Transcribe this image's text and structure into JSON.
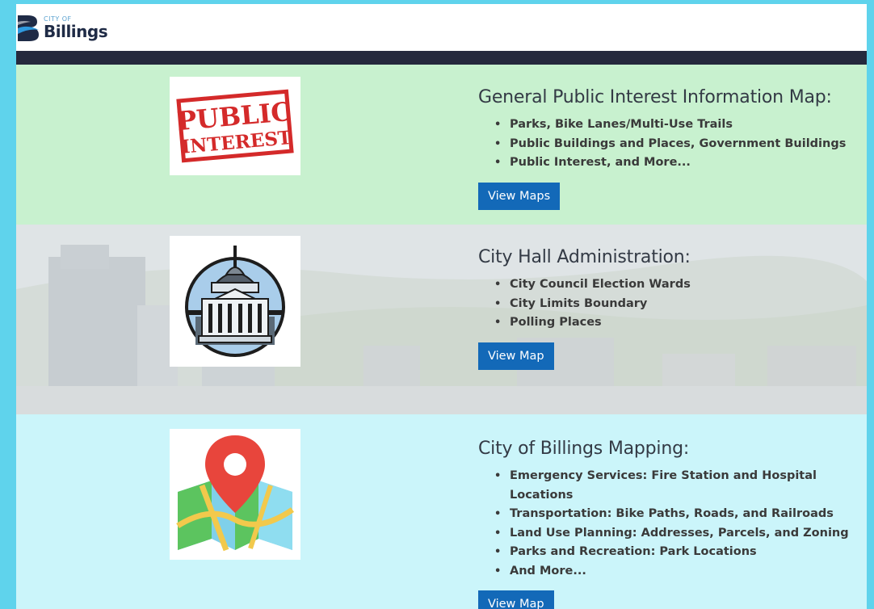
{
  "logo": {
    "small": "CITY OF",
    "big": "Billings"
  },
  "sections": [
    {
      "title": "General Public Interest Information Map:",
      "items": [
        "Parks, Bike Lanes/Multi-Use Trails",
        "Public Buildings and Places, Government Buildings",
        "Public Interest, and More..."
      ],
      "button": "View Maps",
      "stamp": {
        "line1": "PUBLIC",
        "line2": "INTEREST",
        "color": "#d42a2a"
      }
    },
    {
      "title": "City Hall Administration:",
      "items": [
        "City Council Election Wards",
        "City Limits Boundary",
        "Polling Places"
      ],
      "button": "View Map"
    },
    {
      "title": "City of Billings Mapping:",
      "items": [
        "Emergency Services:  Fire Station and Hospital Locations",
        "Transportation:  Bike Paths, Roads, and Railroads",
        "Land Use Planning:  Addresses, Parcels, and Zoning",
        "Parks and Recreation:  Park Locations",
        "And More..."
      ],
      "button": "View Map"
    }
  ],
  "colors": {
    "page_border": "#5fd3ec",
    "navbar": "#25293d",
    "section1_bg": "#c8f1cf",
    "section3_bg": "#cbf5fa",
    "button": "#1369b8"
  }
}
